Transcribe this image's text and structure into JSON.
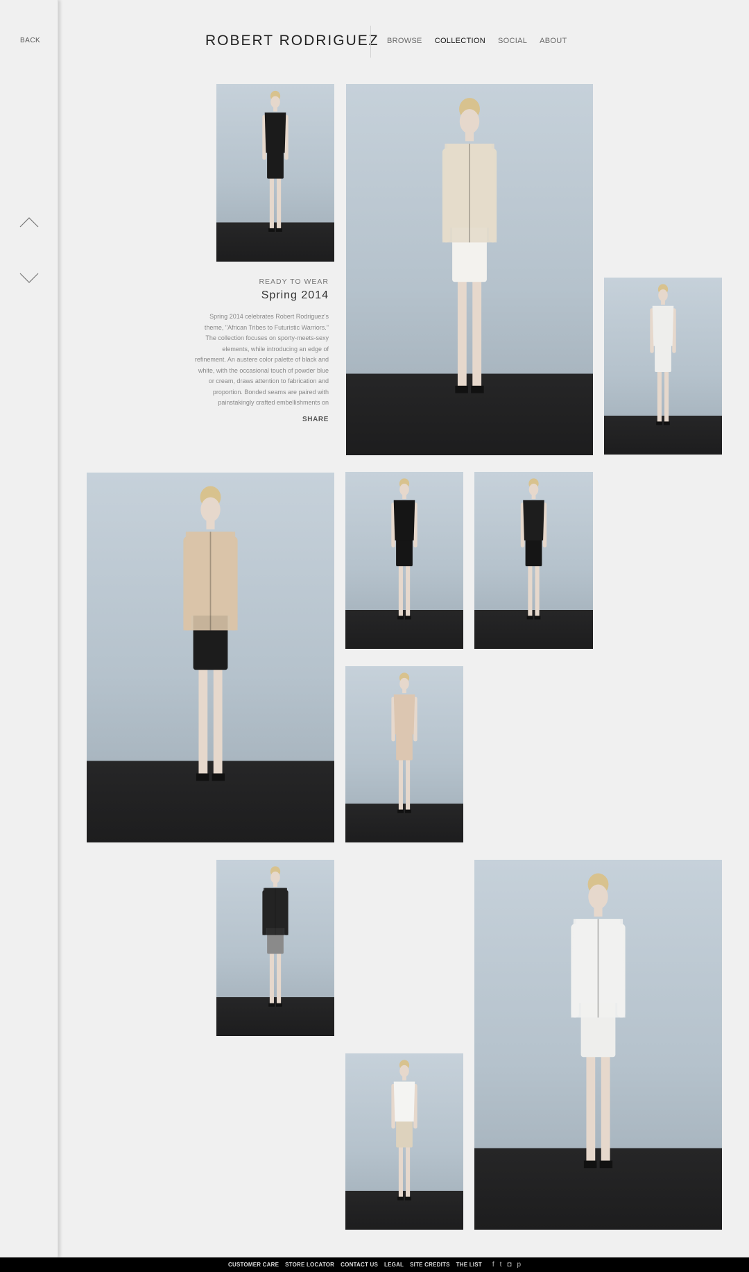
{
  "side_rail": {
    "back_label": "BACK",
    "prev_icon": "chevron-up-icon",
    "next_icon": "chevron-down-icon"
  },
  "header": {
    "brand": "ROBERT RODRIGUEZ",
    "nav": [
      {
        "label": "BROWSE",
        "active": false
      },
      {
        "label": "COLLECTION",
        "active": true
      },
      {
        "label": "SOCIAL",
        "active": false
      },
      {
        "label": "ABOUT",
        "active": false
      }
    ]
  },
  "collection": {
    "category": "READY TO WEAR",
    "season": "Spring 2014",
    "description": "Spring 2014 celebrates Robert Rodriguez's theme, \"African Tribes to Futuristic Warriors.\" The collection focuses on sporty-meets-sexy elements, while introducing an edge of refinement. An austere color palette of black and white, with the occasional touch of powder blue or cream, draws attention to fabrication and proportion. Bonded seams are paired with painstakingly crafted embellishments on",
    "share_label": "SHARE"
  },
  "looks": [
    {
      "top": "#1b1b1b",
      "bottom": "#1b1b1b",
      "jacket": false
    },
    {
      "top": "#e4dccb",
      "bottom": "#f3f2ee",
      "jacket": true
    },
    {
      "top": "#eeeeec",
      "bottom": "#eeeeec",
      "jacket": false
    },
    {
      "top": "#d9c4a8",
      "bottom": "#1c1c1c",
      "jacket": true
    },
    {
      "top": "#151515",
      "bottom": "#151515",
      "jacket": false
    },
    {
      "top": "#1d1d1d",
      "bottom": "#151515",
      "jacket": false
    },
    {
      "top": "#dcc6b1",
      "bottom": "#dcc6b1",
      "jacket": false
    },
    {
      "top": "#242424",
      "bottom": "#8a8a8a",
      "jacket": true
    },
    {
      "top": "#f4f4f2",
      "bottom": "#ddd2bd",
      "jacket": false
    },
    {
      "top": "#f1f1ef",
      "bottom": "#eeeeec",
      "jacket": true
    }
  ],
  "footer": {
    "links": [
      "CUSTOMER CARE",
      "STORE LOCATOR",
      "CONTACT US",
      "LEGAL",
      "SITE CREDITS",
      "THE LIST"
    ],
    "social_icons": [
      {
        "name": "facebook-icon",
        "glyph": "f"
      },
      {
        "name": "twitter-icon",
        "glyph": "t"
      },
      {
        "name": "instagram-icon",
        "glyph": "◘"
      },
      {
        "name": "pinterest-icon",
        "glyph": "p"
      }
    ]
  }
}
